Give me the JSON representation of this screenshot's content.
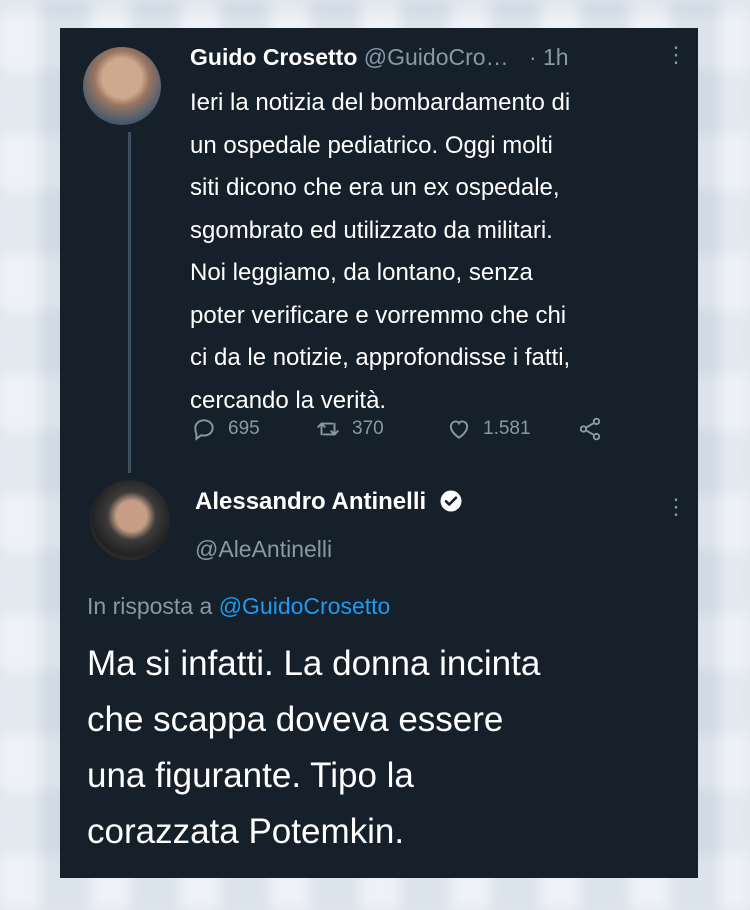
{
  "tweet": {
    "author_name": "Guido Crosetto",
    "author_handle": "@GuidoCro…",
    "time": "· 1h",
    "more_glyph": "⋮",
    "lines": [
      "Ieri la notizia del bombardamento di",
      "un ospedale pediatrico. Oggi molti",
      "siti dicono che era un ex ospedale,",
      "sgombrato ed utilizzato da militari.",
      "Noi leggiamo, da lontano, senza",
      "poter verificare e vorremmo che chi",
      "ci da le notizie, approfondisse i fatti,",
      "cercando la verità."
    ],
    "replies": "695",
    "retweets": "370",
    "likes": "1.581"
  },
  "reply_tweet": {
    "author_name": "Alessandro Antinelli",
    "author_handle": "@AleAntinelli",
    "more_glyph": "⋮",
    "reply_prefix": "In risposta a",
    "reply_to": "@GuidoCrosetto",
    "lines": [
      "Ma si infatti. La donna incinta",
      "che scappa doveva essere",
      "una figurante. Tipo la",
      "corazzata Potemkin."
    ]
  },
  "colors": {
    "card_bg": "#15202b",
    "muted": "#8899a6",
    "accent": "#1d9bf0"
  }
}
